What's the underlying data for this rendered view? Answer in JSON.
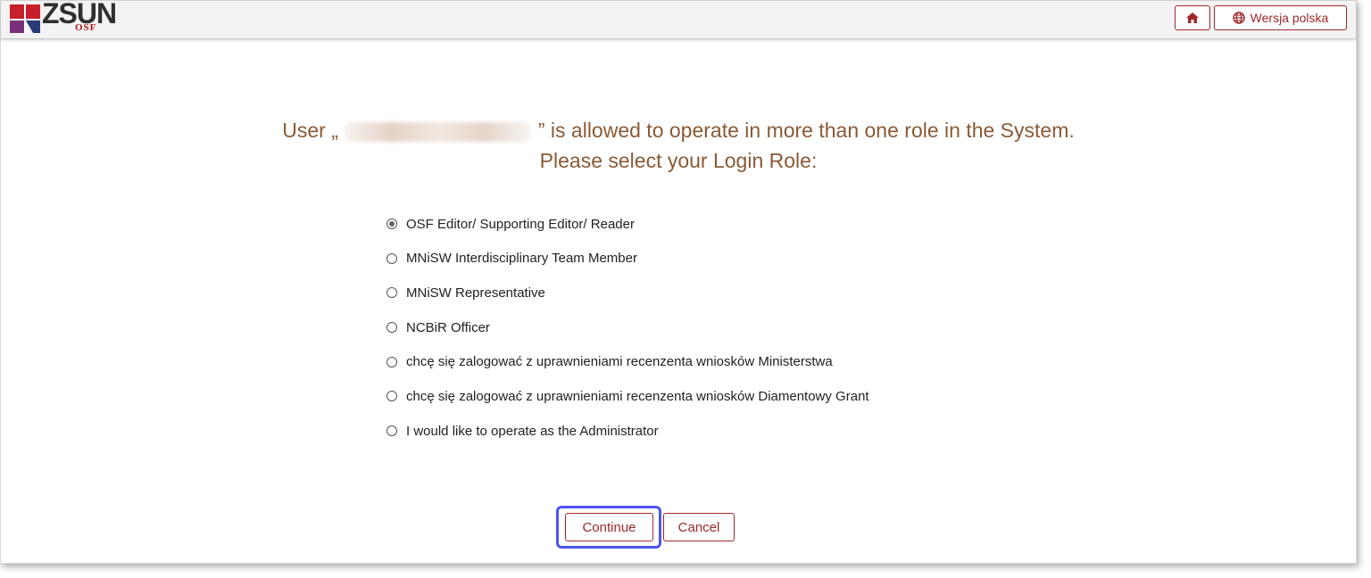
{
  "header": {
    "logo_text": "ZSUN",
    "logo_sub": "OSF",
    "home_icon": "home-icon",
    "language_icon": "globe-icon",
    "language_label": "Wersja polska"
  },
  "prompt": {
    "line1_prefix": "User „",
    "line1_suffix": "” is allowed to operate in more than one role in the System.",
    "line2": "Please select your Login Role:"
  },
  "roles": [
    {
      "label": "OSF Editor/ Supporting Editor/ Reader",
      "checked": true
    },
    {
      "label": "MNiSW Interdisciplinary Team Member",
      "checked": false
    },
    {
      "label": "MNiSW Representative",
      "checked": false
    },
    {
      "label": "NCBiR Officer",
      "checked": false
    },
    {
      "label": "chcę się zalogować z uprawnieniami recenzenta wniosków Ministerstwa",
      "checked": false
    },
    {
      "label": "chcę się zalogować z uprawnieniami recenzenta wniosków Diamentowy Grant",
      "checked": false
    },
    {
      "label": "I would like to operate as the Administrator",
      "checked": false
    }
  ],
  "actions": {
    "continue_label": "Continue",
    "cancel_label": "Cancel"
  },
  "colors": {
    "accent": "#a0282a",
    "heading": "#8a5a36",
    "focus": "#4b55f0"
  }
}
